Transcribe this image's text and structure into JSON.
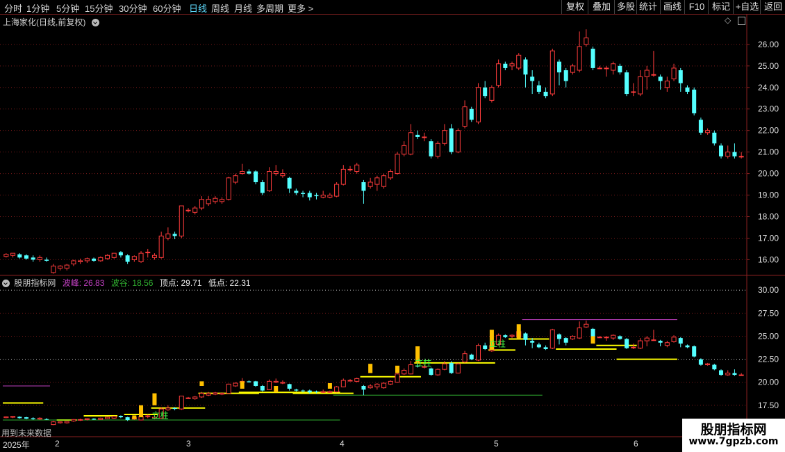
{
  "toolbar": {
    "items": [
      "分时",
      "1分钟",
      "5分钟",
      "15分钟",
      "30分钟",
      "60分钟",
      "日线",
      "周线",
      "月线",
      "多周期",
      "更多 >"
    ],
    "active_index": 6,
    "right_buttons": [
      "复权",
      "叠加",
      "多股",
      "统计",
      "画线",
      "F10",
      "标记",
      "+自选",
      "返回"
    ]
  },
  "main_chart": {
    "title": "上海家化(日线,前复权)",
    "y_labels": [
      "26.00",
      "25.00",
      "24.00",
      "23.00",
      "22.00",
      "21.00",
      "20.00",
      "19.00",
      "18.00",
      "17.00",
      "16.00"
    ]
  },
  "indicator": {
    "name": "股朋指标网",
    "peak_label": "波峰: 26.83",
    "trough_label": "波谷: 18.56",
    "top_label": "顶点: 29.71",
    "low_label": "低点: 22.31",
    "colors": {
      "peak": "#c040c0",
      "trough": "#30b030"
    },
    "y_labels": [
      "30.00",
      "27.50",
      "25.00",
      "22.50",
      "20.00",
      "17.50"
    ],
    "annotation": "立柱"
  },
  "footer": {
    "warning": "用到未来数据",
    "date_labels": [
      "2025年",
      "2",
      "3",
      "4",
      "5",
      "6"
    ]
  },
  "watermark": {
    "line1": "股朋指标网",
    "line2": "www.7gpzb.com"
  },
  "chart_data": {
    "type": "candlestick",
    "title": "上海家化(日线,前复权)",
    "series": [
      {
        "o": 16.15,
        "c": 16.25,
        "h": 16.3,
        "l": 16.1
      },
      {
        "o": 16.2,
        "c": 16.3,
        "h": 16.3,
        "l": 16.1
      },
      {
        "o": 16.25,
        "c": 16.1,
        "h": 16.3,
        "l": 16.05
      },
      {
        "o": 16.2,
        "c": 16.05,
        "h": 16.25,
        "l": 16.0
      },
      {
        "o": 16.1,
        "c": 16.0,
        "h": 16.2,
        "l": 15.9
      },
      {
        "o": 16.0,
        "c": 16.1,
        "h": 16.2,
        "l": 15.9
      },
      {
        "o": 16.0,
        "c": 15.95,
        "h": 16.1,
        "l": 15.9
      },
      {
        "o": 15.4,
        "c": 15.7,
        "h": 15.8,
        "l": 15.35
      },
      {
        "o": 15.6,
        "c": 15.7,
        "h": 15.75,
        "l": 15.5
      },
      {
        "o": 15.6,
        "c": 15.75,
        "h": 15.8,
        "l": 15.5
      },
      {
        "o": 15.8,
        "c": 15.95,
        "h": 16.0,
        "l": 15.7
      },
      {
        "o": 15.9,
        "c": 15.95,
        "h": 16.05,
        "l": 15.8
      },
      {
        "o": 15.95,
        "c": 16.05,
        "h": 16.1,
        "l": 15.85
      },
      {
        "o": 16.05,
        "c": 15.95,
        "h": 16.1,
        "l": 15.9
      },
      {
        "o": 15.95,
        "c": 16.1,
        "h": 16.15,
        "l": 15.9
      },
      {
        "o": 16.05,
        "c": 16.2,
        "h": 16.25,
        "l": 16.0
      },
      {
        "o": 16.1,
        "c": 16.3,
        "h": 16.3,
        "l": 16.05
      },
      {
        "o": 16.35,
        "c": 16.2,
        "h": 16.4,
        "l": 16.1
      },
      {
        "o": 16.2,
        "c": 15.9,
        "h": 16.25,
        "l": 15.8
      },
      {
        "o": 16.0,
        "c": 16.15,
        "h": 16.2,
        "l": 15.9
      },
      {
        "o": 15.9,
        "c": 16.3,
        "h": 16.4,
        "l": 15.85
      },
      {
        "o": 16.35,
        "c": 16.35,
        "h": 16.5,
        "l": 16.1
      },
      {
        "o": 16.1,
        "c": 16.2,
        "h": 16.3,
        "l": 16.0
      },
      {
        "o": 16.1,
        "c": 17.1,
        "h": 17.3,
        "l": 16.05
      },
      {
        "o": 17.0,
        "c": 17.2,
        "h": 17.5,
        "l": 16.9
      },
      {
        "o": 17.2,
        "c": 17.1,
        "h": 17.3,
        "l": 16.95
      },
      {
        "o": 17.1,
        "c": 18.5,
        "h": 18.5,
        "l": 17.0
      },
      {
        "o": 18.3,
        "c": 18.3,
        "h": 18.4,
        "l": 18.2
      },
      {
        "o": 18.2,
        "c": 18.4,
        "h": 18.5,
        "l": 18.1
      },
      {
        "o": 18.4,
        "c": 18.8,
        "h": 18.95,
        "l": 18.3
      },
      {
        "o": 18.6,
        "c": 18.8,
        "h": 18.95,
        "l": 18.5
      },
      {
        "o": 18.7,
        "c": 18.85,
        "h": 18.95,
        "l": 18.6
      },
      {
        "o": 18.7,
        "c": 18.8,
        "h": 18.9,
        "l": 18.6
      },
      {
        "o": 18.8,
        "c": 19.8,
        "h": 19.85,
        "l": 18.75
      },
      {
        "o": 19.6,
        "c": 19.9,
        "h": 20.0,
        "l": 19.5
      },
      {
        "o": 20.0,
        "c": 20.1,
        "h": 20.45,
        "l": 19.95
      },
      {
        "o": 20.1,
        "c": 20.0,
        "h": 20.2,
        "l": 19.95
      },
      {
        "o": 20.1,
        "c": 19.6,
        "h": 20.15,
        "l": 19.5
      },
      {
        "o": 19.6,
        "c": 19.1,
        "h": 19.7,
        "l": 19.0
      },
      {
        "o": 19.2,
        "c": 20.1,
        "h": 20.3,
        "l": 19.15
      },
      {
        "o": 20.0,
        "c": 20.1,
        "h": 20.4,
        "l": 19.9
      },
      {
        "o": 19.9,
        "c": 20.0,
        "h": 20.2,
        "l": 19.8
      },
      {
        "o": 19.8,
        "c": 19.3,
        "h": 19.85,
        "l": 19.1
      },
      {
        "o": 19.2,
        "c": 19.1,
        "h": 19.3,
        "l": 19.0
      },
      {
        "o": 19.1,
        "c": 19.05,
        "h": 19.2,
        "l": 18.9
      },
      {
        "o": 19.1,
        "c": 18.9,
        "h": 19.2,
        "l": 18.75
      },
      {
        "o": 19.0,
        "c": 18.95,
        "h": 19.1,
        "l": 18.8
      },
      {
        "o": 18.9,
        "c": 19.0,
        "h": 19.2,
        "l": 18.85
      },
      {
        "o": 18.9,
        "c": 19.0,
        "h": 19.1,
        "l": 18.85
      },
      {
        "o": 18.95,
        "c": 19.5,
        "h": 19.6,
        "l": 18.9
      },
      {
        "o": 19.5,
        "c": 20.2,
        "h": 20.4,
        "l": 19.45
      },
      {
        "o": 20.2,
        "c": 20.2,
        "h": 20.35,
        "l": 20.1
      },
      {
        "o": 20.1,
        "c": 20.4,
        "h": 20.5,
        "l": 20.0
      },
      {
        "o": 19.6,
        "c": 19.2,
        "h": 19.7,
        "l": 18.6
      },
      {
        "o": 19.4,
        "c": 19.6,
        "h": 19.8,
        "l": 19.3
      },
      {
        "o": 19.5,
        "c": 19.8,
        "h": 19.9,
        "l": 19.2
      },
      {
        "o": 19.4,
        "c": 19.9,
        "h": 20.0,
        "l": 19.3
      },
      {
        "o": 19.8,
        "c": 20.1,
        "h": 20.2,
        "l": 19.7
      },
      {
        "o": 20.0,
        "c": 20.9,
        "h": 21.0,
        "l": 19.95
      },
      {
        "o": 20.9,
        "c": 21.3,
        "h": 21.5,
        "l": 20.8
      },
      {
        "o": 20.9,
        "c": 21.9,
        "h": 22.3,
        "l": 20.85
      },
      {
        "o": 21.8,
        "c": 21.7,
        "h": 22.0,
        "l": 21.6
      },
      {
        "o": 21.7,
        "c": 21.7,
        "h": 21.9,
        "l": 21.5
      },
      {
        "o": 21.5,
        "c": 20.8,
        "h": 21.6,
        "l": 20.7
      },
      {
        "o": 20.8,
        "c": 21.4,
        "h": 21.5,
        "l": 20.7
      },
      {
        "o": 21.4,
        "c": 22.0,
        "h": 22.3,
        "l": 21.3
      },
      {
        "o": 22.1,
        "c": 21.0,
        "h": 22.3,
        "l": 20.9
      },
      {
        "o": 21.0,
        "c": 22.0,
        "h": 22.1,
        "l": 20.95
      },
      {
        "o": 22.2,
        "c": 23.1,
        "h": 23.4,
        "l": 22.1
      },
      {
        "o": 23.0,
        "c": 22.5,
        "h": 23.1,
        "l": 22.4
      },
      {
        "o": 22.4,
        "c": 24.0,
        "h": 24.2,
        "l": 22.3
      },
      {
        "o": 24.0,
        "c": 23.6,
        "h": 24.3,
        "l": 23.5
      },
      {
        "o": 23.4,
        "c": 24.0,
        "h": 24.1,
        "l": 23.3
      },
      {
        "o": 24.1,
        "c": 25.1,
        "h": 25.3,
        "l": 24.0
      },
      {
        "o": 25.1,
        "c": 24.9,
        "h": 25.2,
        "l": 24.8
      },
      {
        "o": 25.0,
        "c": 25.1,
        "h": 25.2,
        "l": 24.8
      },
      {
        "o": 24.9,
        "c": 25.5,
        "h": 25.6,
        "l": 24.8
      },
      {
        "o": 25.3,
        "c": 24.6,
        "h": 25.4,
        "l": 24.0
      },
      {
        "o": 24.5,
        "c": 24.3,
        "h": 24.8,
        "l": 23.7
      },
      {
        "o": 24.1,
        "c": 23.8,
        "h": 24.3,
        "l": 23.7
      },
      {
        "o": 23.8,
        "c": 23.6,
        "h": 24.0,
        "l": 23.5
      },
      {
        "o": 23.7,
        "c": 25.7,
        "h": 25.8,
        "l": 23.6
      },
      {
        "o": 25.2,
        "c": 24.7,
        "h": 25.3,
        "l": 24.1
      },
      {
        "o": 24.8,
        "c": 24.3,
        "h": 24.9,
        "l": 24.0
      },
      {
        "o": 24.7,
        "c": 25.0,
        "h": 25.1,
        "l": 24.6
      },
      {
        "o": 24.8,
        "c": 25.9,
        "h": 26.6,
        "l": 24.7
      },
      {
        "o": 26.0,
        "c": 26.3,
        "h": 26.7,
        "l": 25.9
      },
      {
        "o": 25.8,
        "c": 24.9,
        "h": 25.9,
        "l": 24.8
      },
      {
        "o": 24.9,
        "c": 24.9,
        "h": 25.0,
        "l": 24.85
      },
      {
        "o": 24.9,
        "c": 24.9,
        "h": 25.0,
        "l": 24.5
      },
      {
        "o": 24.8,
        "c": 25.1,
        "h": 25.2,
        "l": 24.6
      },
      {
        "o": 25.0,
        "c": 24.7,
        "h": 25.1,
        "l": 24.6
      },
      {
        "o": 24.7,
        "c": 23.7,
        "h": 24.8,
        "l": 23.6
      },
      {
        "o": 23.8,
        "c": 23.8,
        "h": 24.2,
        "l": 23.6
      },
      {
        "o": 23.7,
        "c": 24.5,
        "h": 24.8,
        "l": 23.6
      },
      {
        "o": 24.5,
        "c": 24.8,
        "h": 25.0,
        "l": 23.9
      },
      {
        "o": 24.6,
        "c": 24.6,
        "h": 25.7,
        "l": 24.5
      },
      {
        "o": 24.5,
        "c": 24.3,
        "h": 24.6,
        "l": 23.9
      },
      {
        "o": 24.0,
        "c": 24.3,
        "h": 24.5,
        "l": 23.8
      },
      {
        "o": 24.4,
        "c": 24.9,
        "h": 25.1,
        "l": 24.3
      },
      {
        "o": 24.8,
        "c": 24.2,
        "h": 24.9,
        "l": 23.8
      },
      {
        "o": 24.0,
        "c": 23.8,
        "h": 24.1,
        "l": 23.7
      },
      {
        "o": 23.9,
        "c": 22.8,
        "h": 24.0,
        "l": 22.7
      },
      {
        "o": 22.5,
        "c": 21.9,
        "h": 22.6,
        "l": 21.8
      },
      {
        "o": 21.9,
        "c": 22.0,
        "h": 22.1,
        "l": 21.8
      },
      {
        "o": 21.9,
        "c": 21.4,
        "h": 22.0,
        "l": 21.3
      },
      {
        "o": 21.3,
        "c": 20.8,
        "h": 21.4,
        "l": 20.7
      },
      {
        "o": 20.8,
        "c": 21.0,
        "h": 21.3,
        "l": 20.7
      },
      {
        "o": 21.0,
        "c": 20.8,
        "h": 21.4,
        "l": 20.7
      },
      {
        "o": 20.8,
        "c": 20.8,
        "h": 21.0,
        "l": 20.7
      }
    ],
    "ylim": [
      15.4,
      26.9
    ],
    "indicator_ylim": [
      15.9,
      31.0
    ],
    "indicator_lines": [
      {
        "color": "#ffff00",
        "level": 17.75,
        "from": 0,
        "to": 5
      },
      {
        "color": "#ffff00",
        "level": 15.9,
        "from": 8,
        "to": 10
      },
      {
        "color": "#ffff00",
        "level": 16.35,
        "from": 12,
        "to": 16
      },
      {
        "color": "#ffff00",
        "level": 16.5,
        "from": 18,
        "to": 22
      },
      {
        "color": "#ffff00",
        "level": 17.2,
        "from": 22,
        "to": 29
      },
      {
        "color": "#ffff00",
        "level": 18.8,
        "from": 29,
        "to": 37
      },
      {
        "color": "#ffff00",
        "level": 18.9,
        "from": 35,
        "to": 49
      },
      {
        "color": "#ffff00",
        "level": 18.8,
        "from": 43,
        "to": 51
      },
      {
        "color": "#ffff00",
        "level": 20.6,
        "from": 53,
        "to": 61
      },
      {
        "color": "#ffff00",
        "level": 22.1,
        "from": 61,
        "to": 72
      },
      {
        "color": "#ffff00",
        "level": 23.5,
        "from": 72,
        "to": 75
      },
      {
        "color": "#ffff00",
        "level": 24.7,
        "from": 75,
        "to": 80
      },
      {
        "color": "#ffff00",
        "level": 23.6,
        "from": 82,
        "to": 90
      },
      {
        "color": "#ffff00",
        "level": 24.0,
        "from": 88,
        "to": 93
      },
      {
        "color": "#ffff00",
        "level": 22.5,
        "from": 91,
        "to": 99
      },
      {
        "color": "#c040c0",
        "level": 19.6,
        "from": 0,
        "to": 6
      },
      {
        "color": "#c040c0",
        "level": 26.8,
        "from": 77,
        "to": 99
      },
      {
        "color": "#30b030",
        "level": 15.9,
        "from": 0,
        "to": 49
      },
      {
        "color": "#30b030",
        "level": 18.6,
        "from": 49,
        "to": 79
      }
    ],
    "yellow_bars": [
      [
        19,
        16.0,
        16.4
      ],
      [
        20,
        16.2,
        17.5
      ],
      [
        22,
        17.5,
        18.8
      ],
      [
        29,
        19.6,
        20.1
      ],
      [
        35,
        19.3,
        20.1
      ],
      [
        40,
        18.9,
        19.6
      ],
      [
        48,
        19.3,
        19.9
      ],
      [
        54,
        21.0,
        22.0
      ],
      [
        58,
        21.0,
        21.8
      ],
      [
        61,
        22.1,
        23.9
      ],
      [
        72,
        23.5,
        25.7
      ],
      [
        76,
        24.7,
        26.3
      ],
      [
        87,
        24.2,
        25.0
      ]
    ]
  }
}
